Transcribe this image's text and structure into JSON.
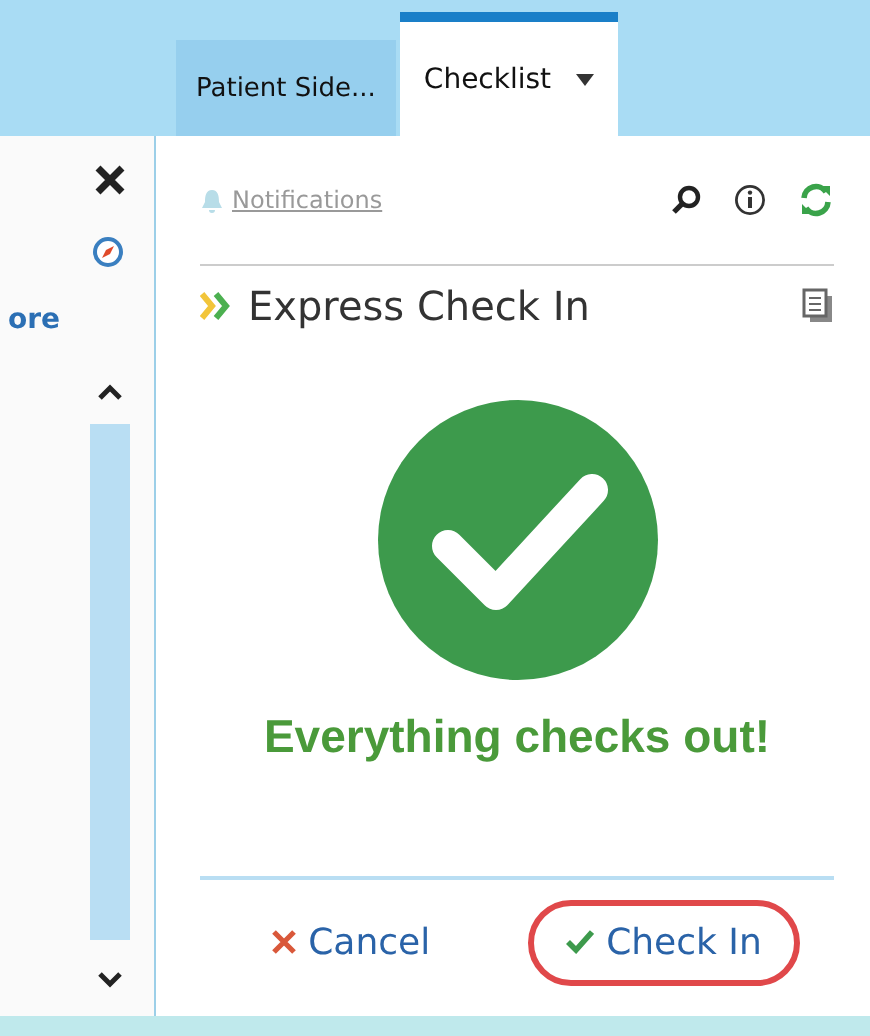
{
  "tabs": [
    {
      "label": "Patient Side...",
      "selected": false,
      "menu": false
    },
    {
      "label": "Checklist",
      "selected": true,
      "menu": true
    }
  ],
  "sidebar": {
    "more_link": "ore"
  },
  "toolbar": {
    "notifications": "Notifications"
  },
  "panel": {
    "title": "Express Check In",
    "message": "Everything checks out!"
  },
  "buttons": [
    {
      "kind": "cancel",
      "label": "Cancel",
      "highlighted": false
    },
    {
      "kind": "confirm",
      "label": "Check In",
      "highlighted": true
    }
  ]
}
